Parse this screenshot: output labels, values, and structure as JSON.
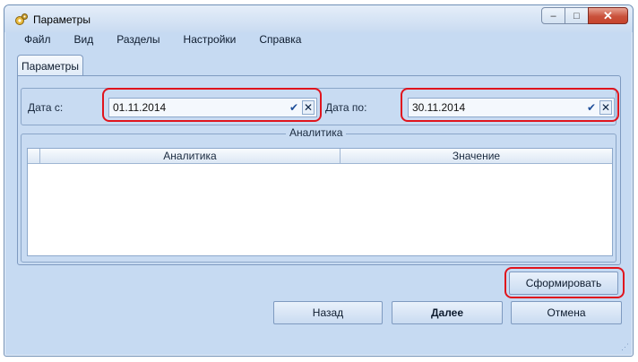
{
  "window": {
    "title": "Параметры",
    "controls": {
      "minimize": "–",
      "maximize": "□",
      "close": "✕"
    }
  },
  "menu": [
    "Файл",
    "Вид",
    "Разделы",
    "Настройки",
    "Справка"
  ],
  "tab": {
    "label": "Параметры"
  },
  "dates": {
    "from_label": "Дата с:",
    "from_value": "01.11.2014",
    "to_label": "Дата по:",
    "to_value": "30.11.2014",
    "confirm_glyph": "✔",
    "clear_glyph": "✕"
  },
  "analytics": {
    "caption": "Аналитика",
    "columns": [
      "Аналитика",
      "Значение"
    ],
    "rows": []
  },
  "buttons": {
    "generate": "Сформировать",
    "back": "Назад",
    "next": "Далее",
    "cancel": "Отмена"
  },
  "colors": {
    "highlight": "#e0141d",
    "window_bg": "#c6daf2"
  }
}
